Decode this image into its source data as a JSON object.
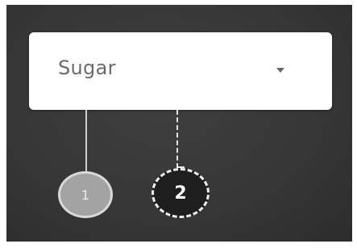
{
  "dropdown": {
    "selected_value": "Sugar",
    "caret_icon": "chevron-down-icon"
  },
  "markers": [
    {
      "label": "1",
      "state": "inactive",
      "color": "#a3a3a3"
    },
    {
      "label": "2",
      "state": "active",
      "color": "#1e1e1e"
    }
  ]
}
